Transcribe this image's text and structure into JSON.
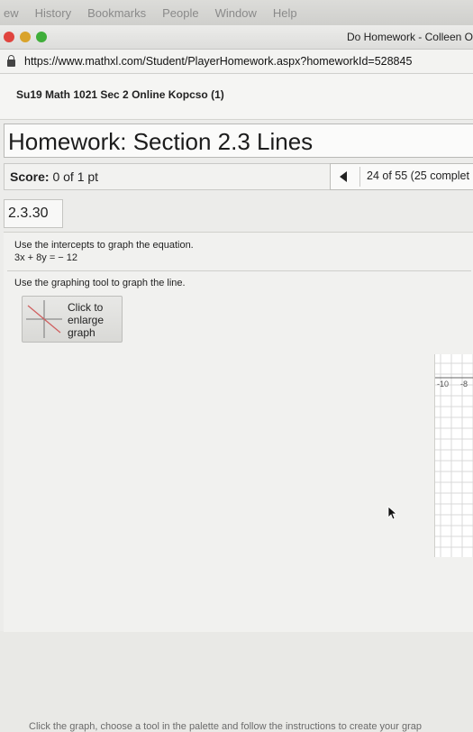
{
  "menubar": {
    "items": [
      "ew",
      "History",
      "Bookmarks",
      "People",
      "Window",
      "Help"
    ]
  },
  "window": {
    "title": "Do Homework - Colleen O"
  },
  "browser": {
    "url": "https://www.mathxl.com/Student/PlayerHomework.aspx?homeworkId=528845"
  },
  "course": {
    "title": "Su19 Math 1021 Sec 2 Online Kopcso (1)"
  },
  "homework": {
    "title": "Homework: Section 2.3 Lines",
    "score_label": "Score:",
    "score_value": "0 of 1 pt",
    "progress_text": "24 of 55 (25 complet",
    "question_number": "2.3.30",
    "instruction": "Use the intercepts to graph the equation.",
    "equation": "3x + 8y = − 12",
    "tool_instruction": "Use the graphing tool to graph the line.",
    "enlarge_label": "Click to enlarge graph",
    "axis_ticks": [
      "-10",
      "-8"
    ],
    "footer_instruction": "Click the graph, choose a tool in the palette and follow the instructions to create your grap"
  }
}
